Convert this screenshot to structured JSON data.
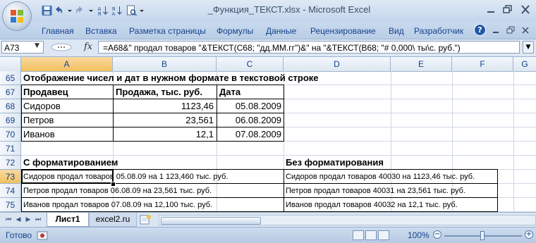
{
  "window": {
    "title": "_Функция_ТЕКСТ.xlsx - Microsoft Excel"
  },
  "ribbon": {
    "tabs": [
      "Главная",
      "Вставка",
      "Разметка страницы",
      "Формулы",
      "Данные",
      "Рецензирование",
      "Вид",
      "Разработчик"
    ]
  },
  "formula_bar": {
    "name_box": "A73",
    "fx": "fx",
    "formula": "=A68&\" продал товаров \"&ТЕКСТ(C68; \"дд.ММ.гг\")&\" на \"&ТЕКСТ(B68; \"# 0,000\\ ты\\с. руб.\")"
  },
  "columns": [
    "A",
    "B",
    "C",
    "D",
    "E",
    "F",
    "G"
  ],
  "rows": [
    "65",
    "67",
    "68",
    "69",
    "70",
    "71",
    "72",
    "73",
    "74",
    "75"
  ],
  "sheet": {
    "heading": "Отображение чисел и дат в нужном формате в текстовой строке",
    "table_headers": [
      "Продавец",
      "Продажа, тыс. руб.",
      "Дата"
    ],
    "table_rows": [
      [
        "Сидоров",
        "1123,46",
        "05.08.2009"
      ],
      [
        "Петров",
        "23,561",
        "06.08.2009"
      ],
      [
        "Иванов",
        "12,1",
        "07.08.2009"
      ]
    ],
    "with_format_title": "С форматированием",
    "without_format_title": "Без форматирования",
    "with_format": [
      "Сидоров продал товаров 05.08.09 на 1 123,460 тыс. руб.",
      "Петров продал товаров 06.08.09 на 23,561 тыс. руб.",
      "Иванов продал товаров 07.08.09 на 12,100 тыс. руб."
    ],
    "without_format": [
      "Сидоров продал товаров 40030 на 1123,46 тыс. руб.",
      "Петров продал товаров 40031 на 23,561 тыс. руб.",
      "Иванов продал товаров 40032 на 12,1 тыс. руб."
    ]
  },
  "sheet_tabs": [
    "Лист1",
    "excel2.ru"
  ],
  "status": {
    "ready": "Готово",
    "zoom": "100%"
  },
  "colors": {
    "ribbon_text": "#15428b",
    "selected_header": "#f1c15f",
    "grid_line": "#d0d7e5"
  }
}
